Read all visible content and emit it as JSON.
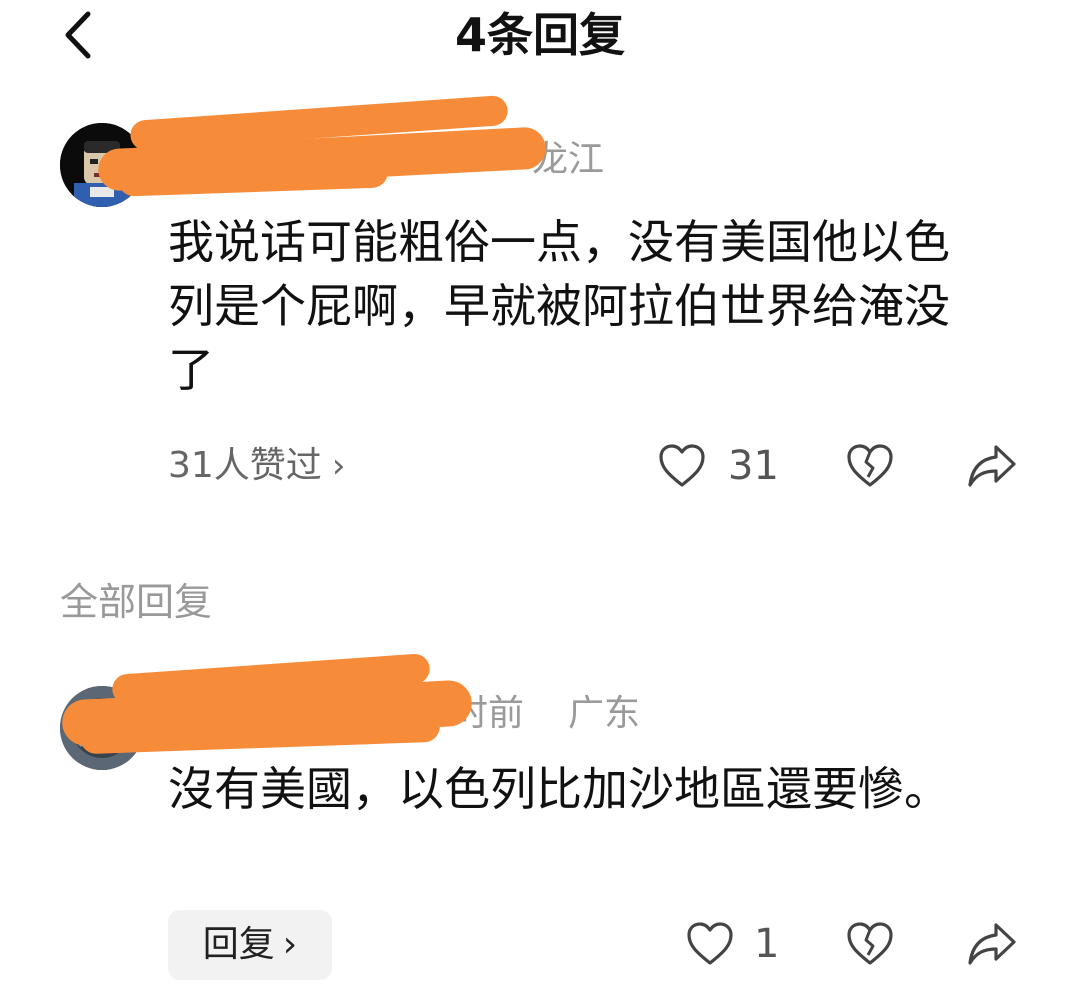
{
  "header": {
    "title": "4条回复",
    "back_icon": "chevron-left-icon"
  },
  "colors": {
    "redaction": "#f68c3a",
    "muted_text": "#9a9a9a",
    "reply_button_bg": "#f2f2f2"
  },
  "main_comment": {
    "meta_visible_fragment": "龙江",
    "body": "我说话可能粗俗一点，没有美国他以色列是个屁啊，早就被阿拉伯世界给淹没了",
    "likes_summary": "31人赞过",
    "like_count": "31",
    "icons": [
      "heart-icon",
      "broken-heart-icon",
      "share-icon"
    ]
  },
  "section": {
    "label": "全部回复"
  },
  "reply": {
    "meta_visible_fragment": "时前",
    "location": "广东",
    "body": "沒有美國，以色列比加沙地區還要慘。",
    "reply_button_label": "回复",
    "like_count": "1",
    "icons": [
      "heart-icon",
      "broken-heart-icon",
      "share-icon"
    ]
  }
}
